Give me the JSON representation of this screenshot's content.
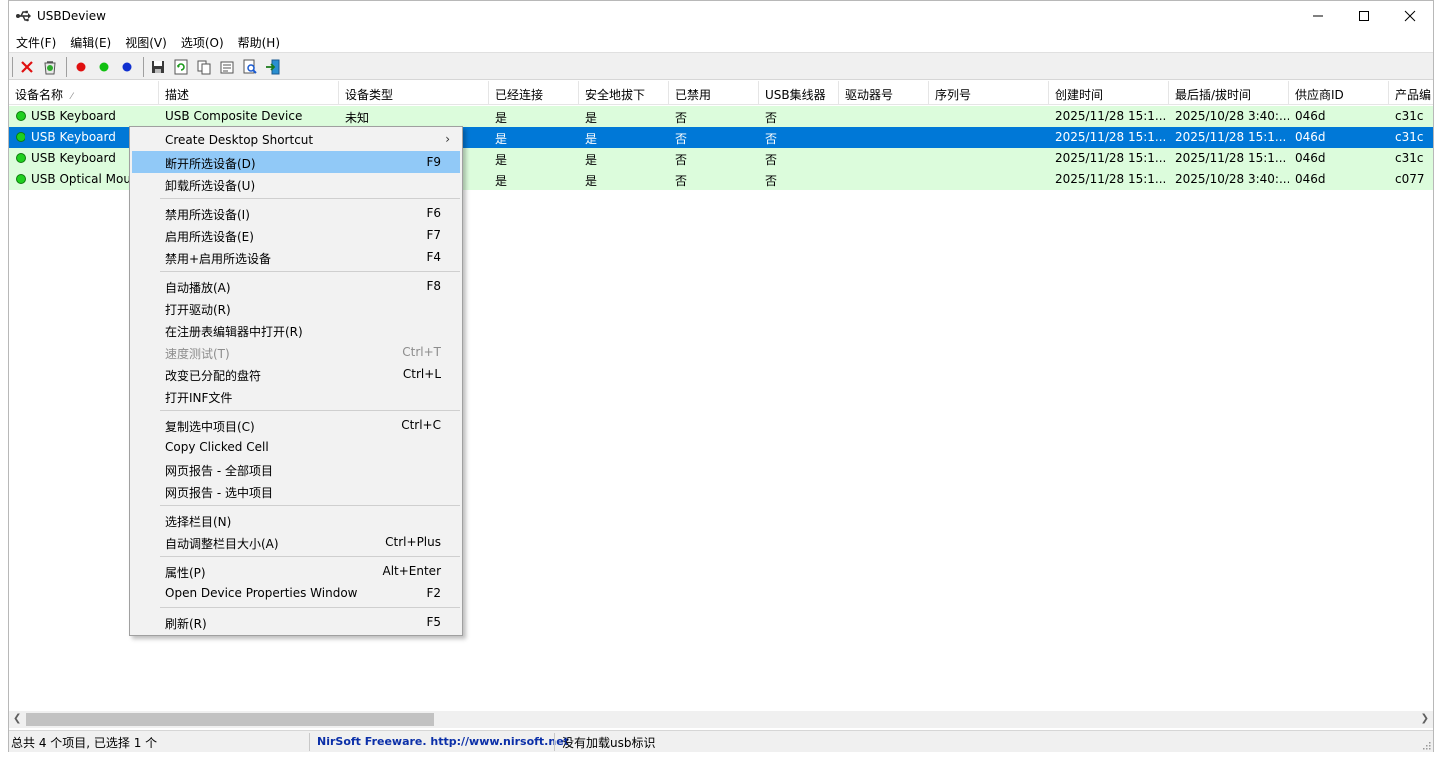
{
  "window": {
    "title": "USBDeview"
  },
  "menubar": [
    "文件(F)",
    "编辑(E)",
    "视图(V)",
    "选项(O)",
    "帮助(H)"
  ],
  "columns": [
    "设备名称",
    "描述",
    "设备类型",
    "已经连接",
    "安全地拔下",
    "已禁用",
    "USB集线器",
    "驱动器号",
    "序列号",
    "创建时间",
    "最后插/拔时间",
    "供应商ID",
    "产品编"
  ],
  "rows": [
    {
      "name": "USB Keyboard",
      "desc": "USB Composite Device",
      "type": "未知",
      "connected": "是",
      "safe": "是",
      "disabled": "否",
      "hub": "否",
      "drive": "",
      "serial": "",
      "created": "2025/11/28 15:1...",
      "last": "2025/10/28 3:40:...",
      "vendor": "046d",
      "product": "c31c"
    },
    {
      "name": "USB Keyboard",
      "desc": "",
      "type": "",
      "connected": "是",
      "safe": "是",
      "disabled": "否",
      "hub": "否",
      "drive": "",
      "serial": "",
      "created": "2025/11/28 15:1...",
      "last": "2025/11/28 15:1...",
      "vendor": "046d",
      "product": "c31c"
    },
    {
      "name": "USB Keyboard",
      "desc": "",
      "type": "",
      "connected": "是",
      "safe": "是",
      "disabled": "否",
      "hub": "否",
      "drive": "",
      "serial": "",
      "created": "2025/11/28 15:1...",
      "last": "2025/11/28 15:1...",
      "vendor": "046d",
      "product": "c31c"
    },
    {
      "name": "USB Optical Mou",
      "desc": "",
      "type": "",
      "connected": "是",
      "safe": "是",
      "disabled": "否",
      "hub": "否",
      "drive": "",
      "serial": "",
      "created": "2025/11/28 15:1...",
      "last": "2025/10/28 3:40:...",
      "vendor": "046d",
      "product": "c077"
    }
  ],
  "context_menu": {
    "items": [
      {
        "label": "Create Desktop Shortcut",
        "key": "",
        "submenu": true
      },
      {
        "label": "断开所选设备(D)",
        "key": "F9"
      },
      {
        "label": "卸载所选设备(U)",
        "key": ""
      },
      {
        "label": "禁用所选设备(I)",
        "key": "F6"
      },
      {
        "label": "启用所选设备(E)",
        "key": "F7"
      },
      {
        "label": "禁用+启用所选设备",
        "key": "F4"
      },
      {
        "label": "自动播放(A)",
        "key": "F8"
      },
      {
        "label": "打开驱动(R)",
        "key": ""
      },
      {
        "label": "在注册表编辑器中打开(R)",
        "key": ""
      },
      {
        "label": "速度测试(T)",
        "key": "Ctrl+T",
        "disabled": true
      },
      {
        "label": "改变已分配的盘符",
        "key": "Ctrl+L"
      },
      {
        "label": "打开INF文件",
        "key": ""
      },
      {
        "label": "复制选中项目(C)",
        "key": "Ctrl+C"
      },
      {
        "label": "Copy Clicked Cell",
        "key": ""
      },
      {
        "label": "网页报告 - 全部项目",
        "key": ""
      },
      {
        "label": "网页报告 - 选中项目",
        "key": ""
      },
      {
        "label": "选择栏目(N)",
        "key": ""
      },
      {
        "label": "自动调整栏目大小(A)",
        "key": "Ctrl+Plus"
      },
      {
        "label": "属性(P)",
        "key": "Alt+Enter"
      },
      {
        "label": "Open Device Properties Window",
        "key": "F2"
      },
      {
        "label": "刷新(R)",
        "key": "F5"
      }
    ]
  },
  "statusbar": {
    "count": "总共 4 个项目, 已选择 1 个",
    "link": "NirSoft Freeware.  http://www.nirsoft.net",
    "message": "没有加载usb标识"
  },
  "colors": {
    "row_bg": "#dcfcdc",
    "selected": "#0078d7",
    "highlight": "#91c9f7",
    "link": "#0b2fa8"
  },
  "icons": [
    "usb-app-icon",
    "disconnect-icon",
    "uninstall-icon",
    "red-dot-icon",
    "green-dot-icon",
    "blue-dot-icon",
    "save-icon",
    "refresh-icon",
    "copy-icon",
    "properties-icon",
    "find-icon",
    "exit-icon"
  ]
}
